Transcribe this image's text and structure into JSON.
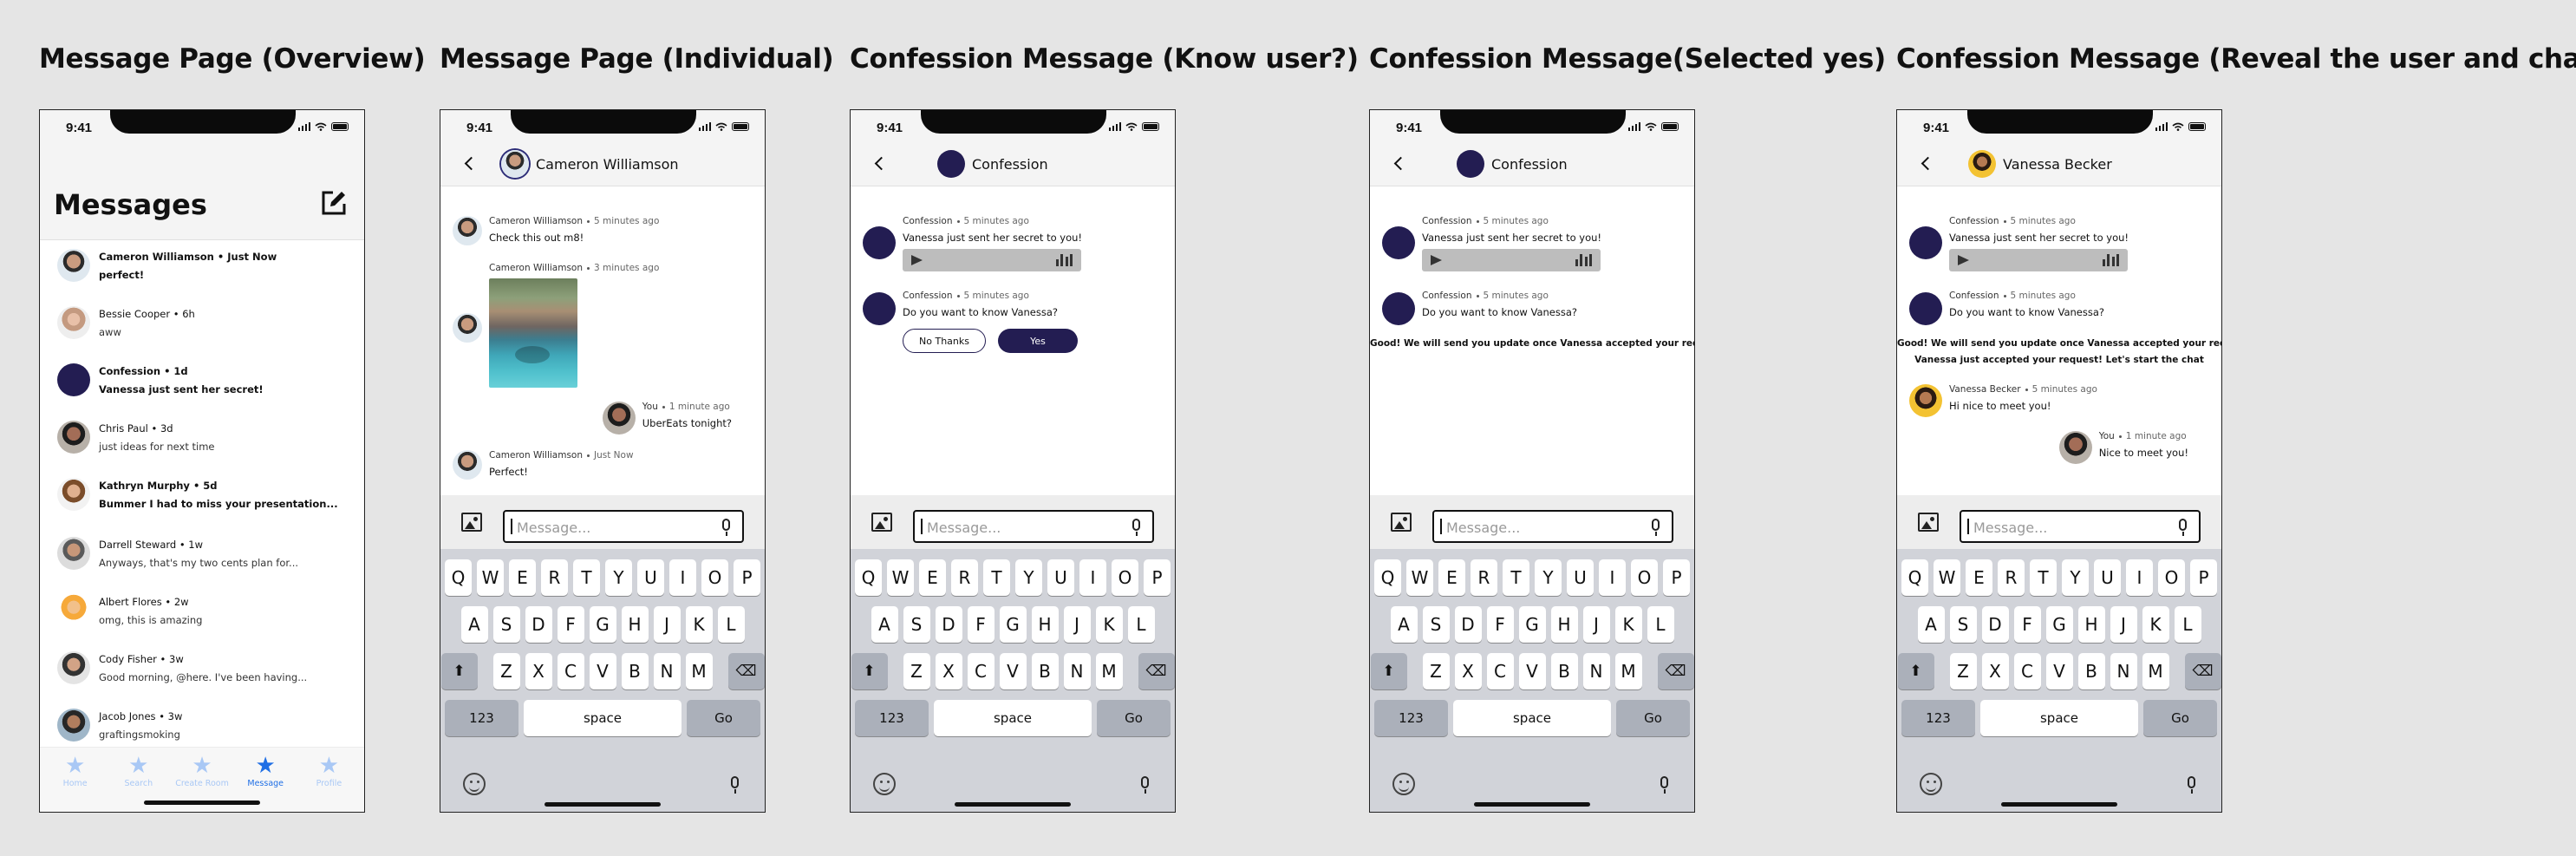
{
  "frames": [
    {
      "title": "Message Page (Overview)"
    },
    {
      "title": "Message Page (Individual)"
    },
    {
      "title": "Confession Message (Know user?)"
    },
    {
      "title": "Confession Message(Selected yes)"
    },
    {
      "title": "Confession Message (Reveal the user and chat)"
    }
  ],
  "status_time": "9:41",
  "overview": {
    "title": "Messages",
    "conversations": [
      {
        "name": "Cameron Williamson",
        "time": "Just Now",
        "preview": "perfect!",
        "unread": true,
        "avatar": "p1"
      },
      {
        "name": "Bessie Cooper",
        "time": "6h",
        "preview": "aww",
        "unread": false,
        "avatar": "p2"
      },
      {
        "name": "Confession",
        "time": "1d",
        "preview": "Vanessa just sent her secret!",
        "unread": true,
        "avatar": "navy"
      },
      {
        "name": "Chris Paul",
        "time": "3d",
        "preview": "just ideas for next time",
        "unread": false,
        "avatar": "p3"
      },
      {
        "name": "Kathryn Murphy",
        "time": "5d",
        "preview": "Bummer I had to miss your presentation...",
        "unread": true,
        "avatar": "p4"
      },
      {
        "name": "Darrell Steward",
        "time": "1w",
        "preview": "Anyways, that's my two cents plan for...",
        "unread": false,
        "avatar": "p5"
      },
      {
        "name": "Albert Flores",
        "time": "2w",
        "preview": "omg, this is amazing",
        "unread": false,
        "avatar": "p6"
      },
      {
        "name": "Cody Fisher",
        "time": "3w",
        "preview": "Good morning, @here. I've been having...",
        "unread": false,
        "avatar": "p7"
      },
      {
        "name": "Jacob Jones",
        "time": "3w",
        "preview": "graftingsmoking",
        "unread": false,
        "avatar": "p8"
      }
    ],
    "tabs": [
      {
        "label": "Home",
        "active": false
      },
      {
        "label": "Search",
        "active": false
      },
      {
        "label": "Create Room",
        "active": false
      },
      {
        "label": "Message",
        "active": true
      },
      {
        "label": "Profile",
        "active": false
      }
    ]
  },
  "individual": {
    "header_name": "Cameron Williamson",
    "messages": [
      {
        "sender": "Cameron Williamson",
        "time": "5 minutes ago",
        "text": "Check this out m8!"
      },
      {
        "sender": "Cameron Williamson",
        "time": "3 minutes ago",
        "text": ""
      },
      {
        "sender": "You",
        "time": "1 minute ago",
        "text": "UberEats tonight?"
      },
      {
        "sender": "Cameron Williamson",
        "time": "Just Now",
        "text": "Perfect!"
      }
    ]
  },
  "confession": {
    "header_name": "Confession",
    "sender": "Confession",
    "time": "5 minutes ago",
    "msg1": "Vanessa just sent her secret to you!",
    "msg2": "Do you want to know Vanessa?",
    "btn_no": "No Thanks",
    "btn_yes": "Yes",
    "note_yes": "Good! We will send you update once Vanessa accepted your request",
    "note_accepted": "Vanessa just accepted your request! Let's start the chat"
  },
  "reveal": {
    "header_name": "Vanessa Becker",
    "vanessa_msg": {
      "sender": "Vanessa Becker",
      "time": "5 minutes ago",
      "text": "Hi nice to meet you!"
    },
    "you_msg": {
      "sender": "You",
      "time": "1 minute ago",
      "text": "Nice to meet you!"
    }
  },
  "composer": {
    "placeholder": "Message..."
  },
  "keyboard": {
    "row1": [
      "Q",
      "W",
      "E",
      "R",
      "T",
      "Y",
      "U",
      "I",
      "O",
      "P"
    ],
    "row2": [
      "A",
      "S",
      "D",
      "F",
      "G",
      "H",
      "J",
      "K",
      "L"
    ],
    "row3": [
      "Z",
      "X",
      "C",
      "V",
      "B",
      "N",
      "M"
    ],
    "numbers": "123",
    "space": "space",
    "go": "Go"
  },
  "icons": [
    "signal-icon",
    "wifi-icon",
    "battery-icon",
    "back-icon",
    "compose-icon",
    "image-icon",
    "mic-icon",
    "emoji-icon",
    "backspace-icon",
    "shift-icon",
    "star-icon",
    "play-icon",
    "waveform-icon"
  ]
}
